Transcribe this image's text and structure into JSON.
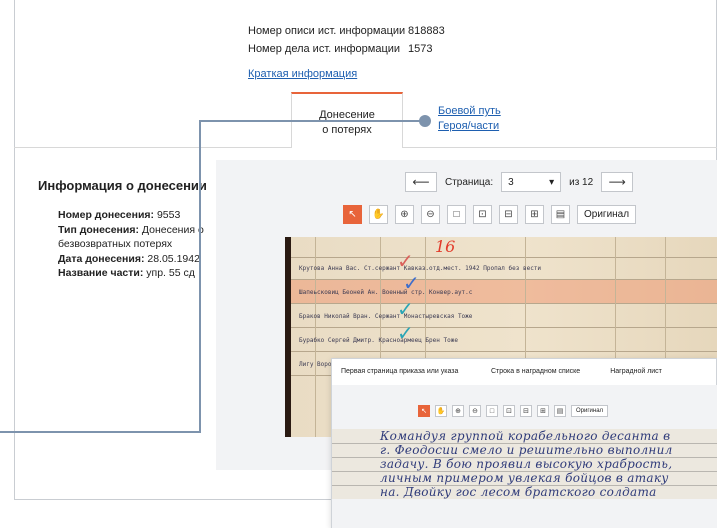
{
  "meta": {
    "rows": [
      {
        "label": "Номер описи ист. информации",
        "value": "818883"
      },
      {
        "label": "Номер дела ист. информации",
        "value": "1573"
      }
    ],
    "brief_link": "Краткая информация"
  },
  "tabs": {
    "active_line1": "Донесение",
    "active_line2": "о потерях",
    "link_line1": "Боевой путь",
    "link_line2": "Героя/части"
  },
  "info": {
    "title": "Информация о донесении",
    "items": [
      {
        "label": "Номер донесения:",
        "value": "9553"
      },
      {
        "label": "Тип донесения:",
        "value": "Донесения о безвозвратных потерях"
      },
      {
        "label": "Дата донесения:",
        "value": "28.05.1942"
      },
      {
        "label": "Название части:",
        "value": "упр. 55 сд"
      }
    ]
  },
  "pager": {
    "prev": "⟵",
    "label": "Страница:",
    "current": "3",
    "total": "из 12",
    "next": "⟶"
  },
  "toolbar": {
    "original": "Оригинал"
  },
  "document_scan": {
    "marker": "16",
    "rows": [
      "Крутова Анна Вас.   Ст.сержант   Кавказ.отд.мест.   1942   Пропал без вести",
      "Шапеьсковиц Беоней Ан.   Военный стр.   Конвер.аут.с",
      "Браков Николай Вран.   Сержант   Монастыревская   Тоже",
      "Бурабко Сергей Дмитр.   Красноармеец   Брен   Тоже",
      "Лигу Ворован Кавез.   ...   ...   Тоже"
    ]
  },
  "overlay": {
    "tabs": [
      "Первая страница приказа или указа",
      "Строка в наградном списке",
      "Наградной лист"
    ],
    "original": "Оригинал",
    "handwriting": [
      "Командуя группой корабельного десанта в",
      "г. Феодосии смело и решительно выполнил",
      "задачу. В бою проявил высокую храбрость,",
      "личным примером увлекая бойцов в атаку",
      "на. Двойку гос лесом братского солдата"
    ]
  }
}
